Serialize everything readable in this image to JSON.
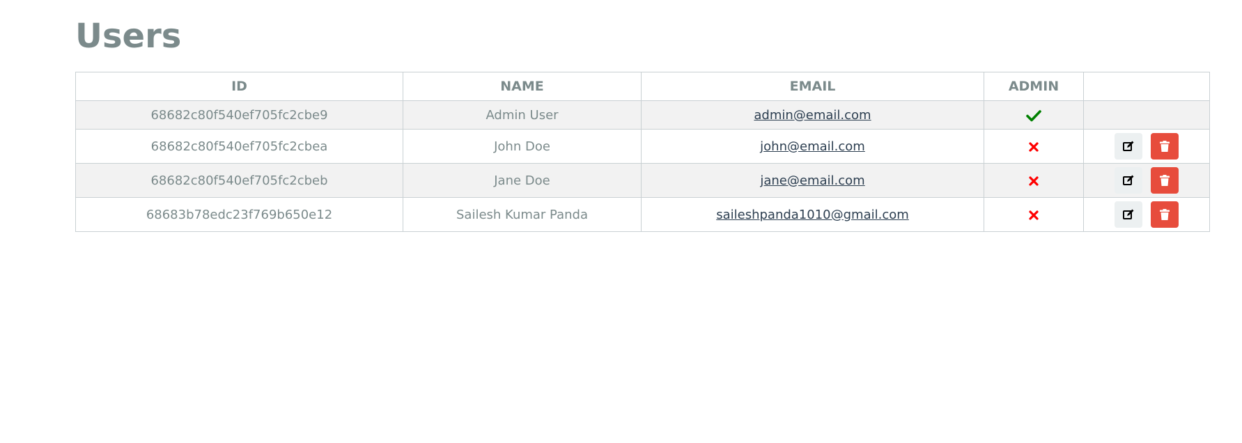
{
  "page": {
    "title": "Users"
  },
  "table": {
    "headers": {
      "id": "ID",
      "name": "NAME",
      "email": "EMAIL",
      "admin": "ADMIN",
      "actions": ""
    },
    "rows": [
      {
        "id": "68682c80f540ef705fc2cbe9",
        "name": "Admin User",
        "email": "admin@email.com",
        "admin": true,
        "admin_icon": "check-icon",
        "actions": false
      },
      {
        "id": "68682c80f540ef705fc2cbea",
        "name": "John Doe",
        "email": "john@email.com",
        "admin": false,
        "admin_icon": "times-icon",
        "actions": true
      },
      {
        "id": "68682c80f540ef705fc2cbeb",
        "name": "Jane Doe",
        "email": "jane@email.com",
        "admin": false,
        "admin_icon": "times-icon",
        "actions": true
      },
      {
        "id": "68683b78edc23f769b650e12",
        "name": "Sailesh Kumar Panda",
        "email": "saileshpanda1010@gmail.com",
        "admin": false,
        "admin_icon": "times-icon",
        "actions": true
      }
    ]
  },
  "icons": {
    "edit": "edit-icon",
    "delete": "trash-icon"
  },
  "colors": {
    "heading": "#7b8a8b",
    "link": "#2c3e50",
    "admin_yes": "#008000",
    "admin_no": "#ff0000",
    "delete_button": "#e74c3c",
    "edit_button": "#ecf0f1",
    "stripe": "#f2f2f2"
  }
}
